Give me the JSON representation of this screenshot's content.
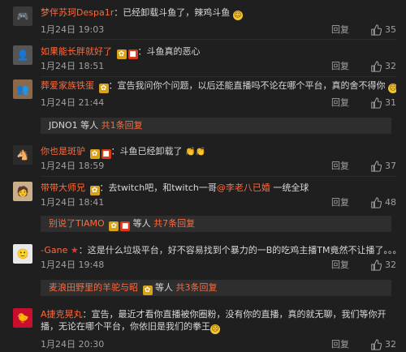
{
  "colors": {
    "background": "#1f1f1f",
    "username": "#ff6a3d",
    "text": "#d8d8d8",
    "meta": "#a0a0a0",
    "reply_box": "#2e2e2e"
  },
  "comments": [
    {
      "username": "梦伴苏珂Despa1r",
      "text": "：已经卸载斗鱼了，辣鸡斗鱼",
      "emoji": "sweat-smile",
      "date": "1月24日 19:03",
      "reply_label": "回复",
      "likes": "35"
    },
    {
      "username": "如果能长胖就好了",
      "text": "：斗鱼真的恶心",
      "date": "1月24日 18:51",
      "reply_label": "回复",
      "likes": "32"
    },
    {
      "username": "葬爱家族铁蛋",
      "text": "：宣告我问你个问题，以后还能直播吗不论在哪个平台，真的舍不得你",
      "emoji": "crying",
      "date": "1月24日 21:44",
      "reply_label": "回复",
      "likes": "31",
      "replies": {
        "who": "JDNO1",
        "mid": " 等人 ",
        "tail": "共1条回复"
      }
    },
    {
      "username": "你也是斑驴",
      "text": "：斗鱼已经卸载了",
      "emoji": "clap",
      "date": "1月24日 18:59",
      "reply_label": "回复",
      "likes": "37"
    },
    {
      "username": "带带大师兄",
      "text": "：去twitch吧，和twitch一哥",
      "mention": "@李老八已婚",
      "text_after": " 一统全球",
      "date": "1月24日 18:41",
      "reply_label": "回复",
      "likes": "48",
      "replies": {
        "who": "别说了TIAMO",
        "mid": " 等人 ",
        "tail": "共7条回复"
      }
    },
    {
      "username": "-Gane",
      "text": "：这是什么垃圾平台，好不容易找到个暴力的一B的吃鸡主播TM竟然不让播了。。。",
      "date": "1月24日 19:48",
      "reply_label": "回复",
      "likes": "32",
      "replies": {
        "who": "麦浪田野里的羊驼与昭",
        "mid": " 等人 ",
        "tail": "共3条回复"
      }
    },
    {
      "username": "A捷克晃丸",
      "text": "：宣告，最近才看你直播被你圈粉，没有你的直播，真的就无聊，我们等你开播，无论在哪个平台，你依旧是我们的拳王",
      "emoji": "crying",
      "date": "1月24日 20:30",
      "reply_label": "回复",
      "likes": "32"
    }
  ]
}
